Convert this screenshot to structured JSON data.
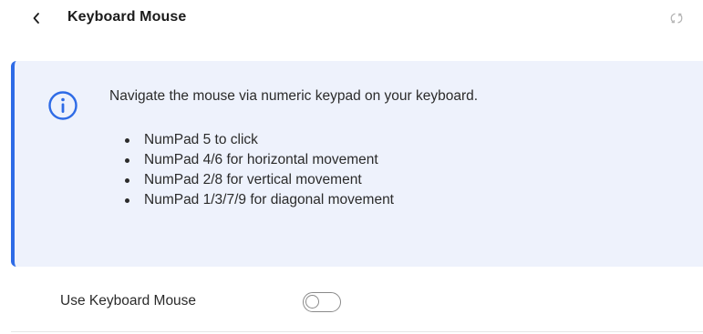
{
  "header": {
    "title": "Keyboard Mouse",
    "back_icon": "chevron-left-icon",
    "reset_icon": "reset-icon"
  },
  "info": {
    "icon": "info-icon",
    "intro": "Navigate the mouse via numeric keypad on your keyboard.",
    "items": [
      {
        "text": "NumPad 5 to click"
      },
      {
        "text": "NumPad 4/6 for horizontal movement"
      },
      {
        "text": "NumPad 2/8 for vertical movement"
      },
      {
        "text": "NumPad 1/3/7/9 for diagonal movement"
      }
    ]
  },
  "setting": {
    "label": "Use Keyboard Mouse",
    "enabled": false
  },
  "colors": {
    "accent": "#2e6be6",
    "panel_background": "#eef2fc",
    "text": "#2b2b2b"
  }
}
